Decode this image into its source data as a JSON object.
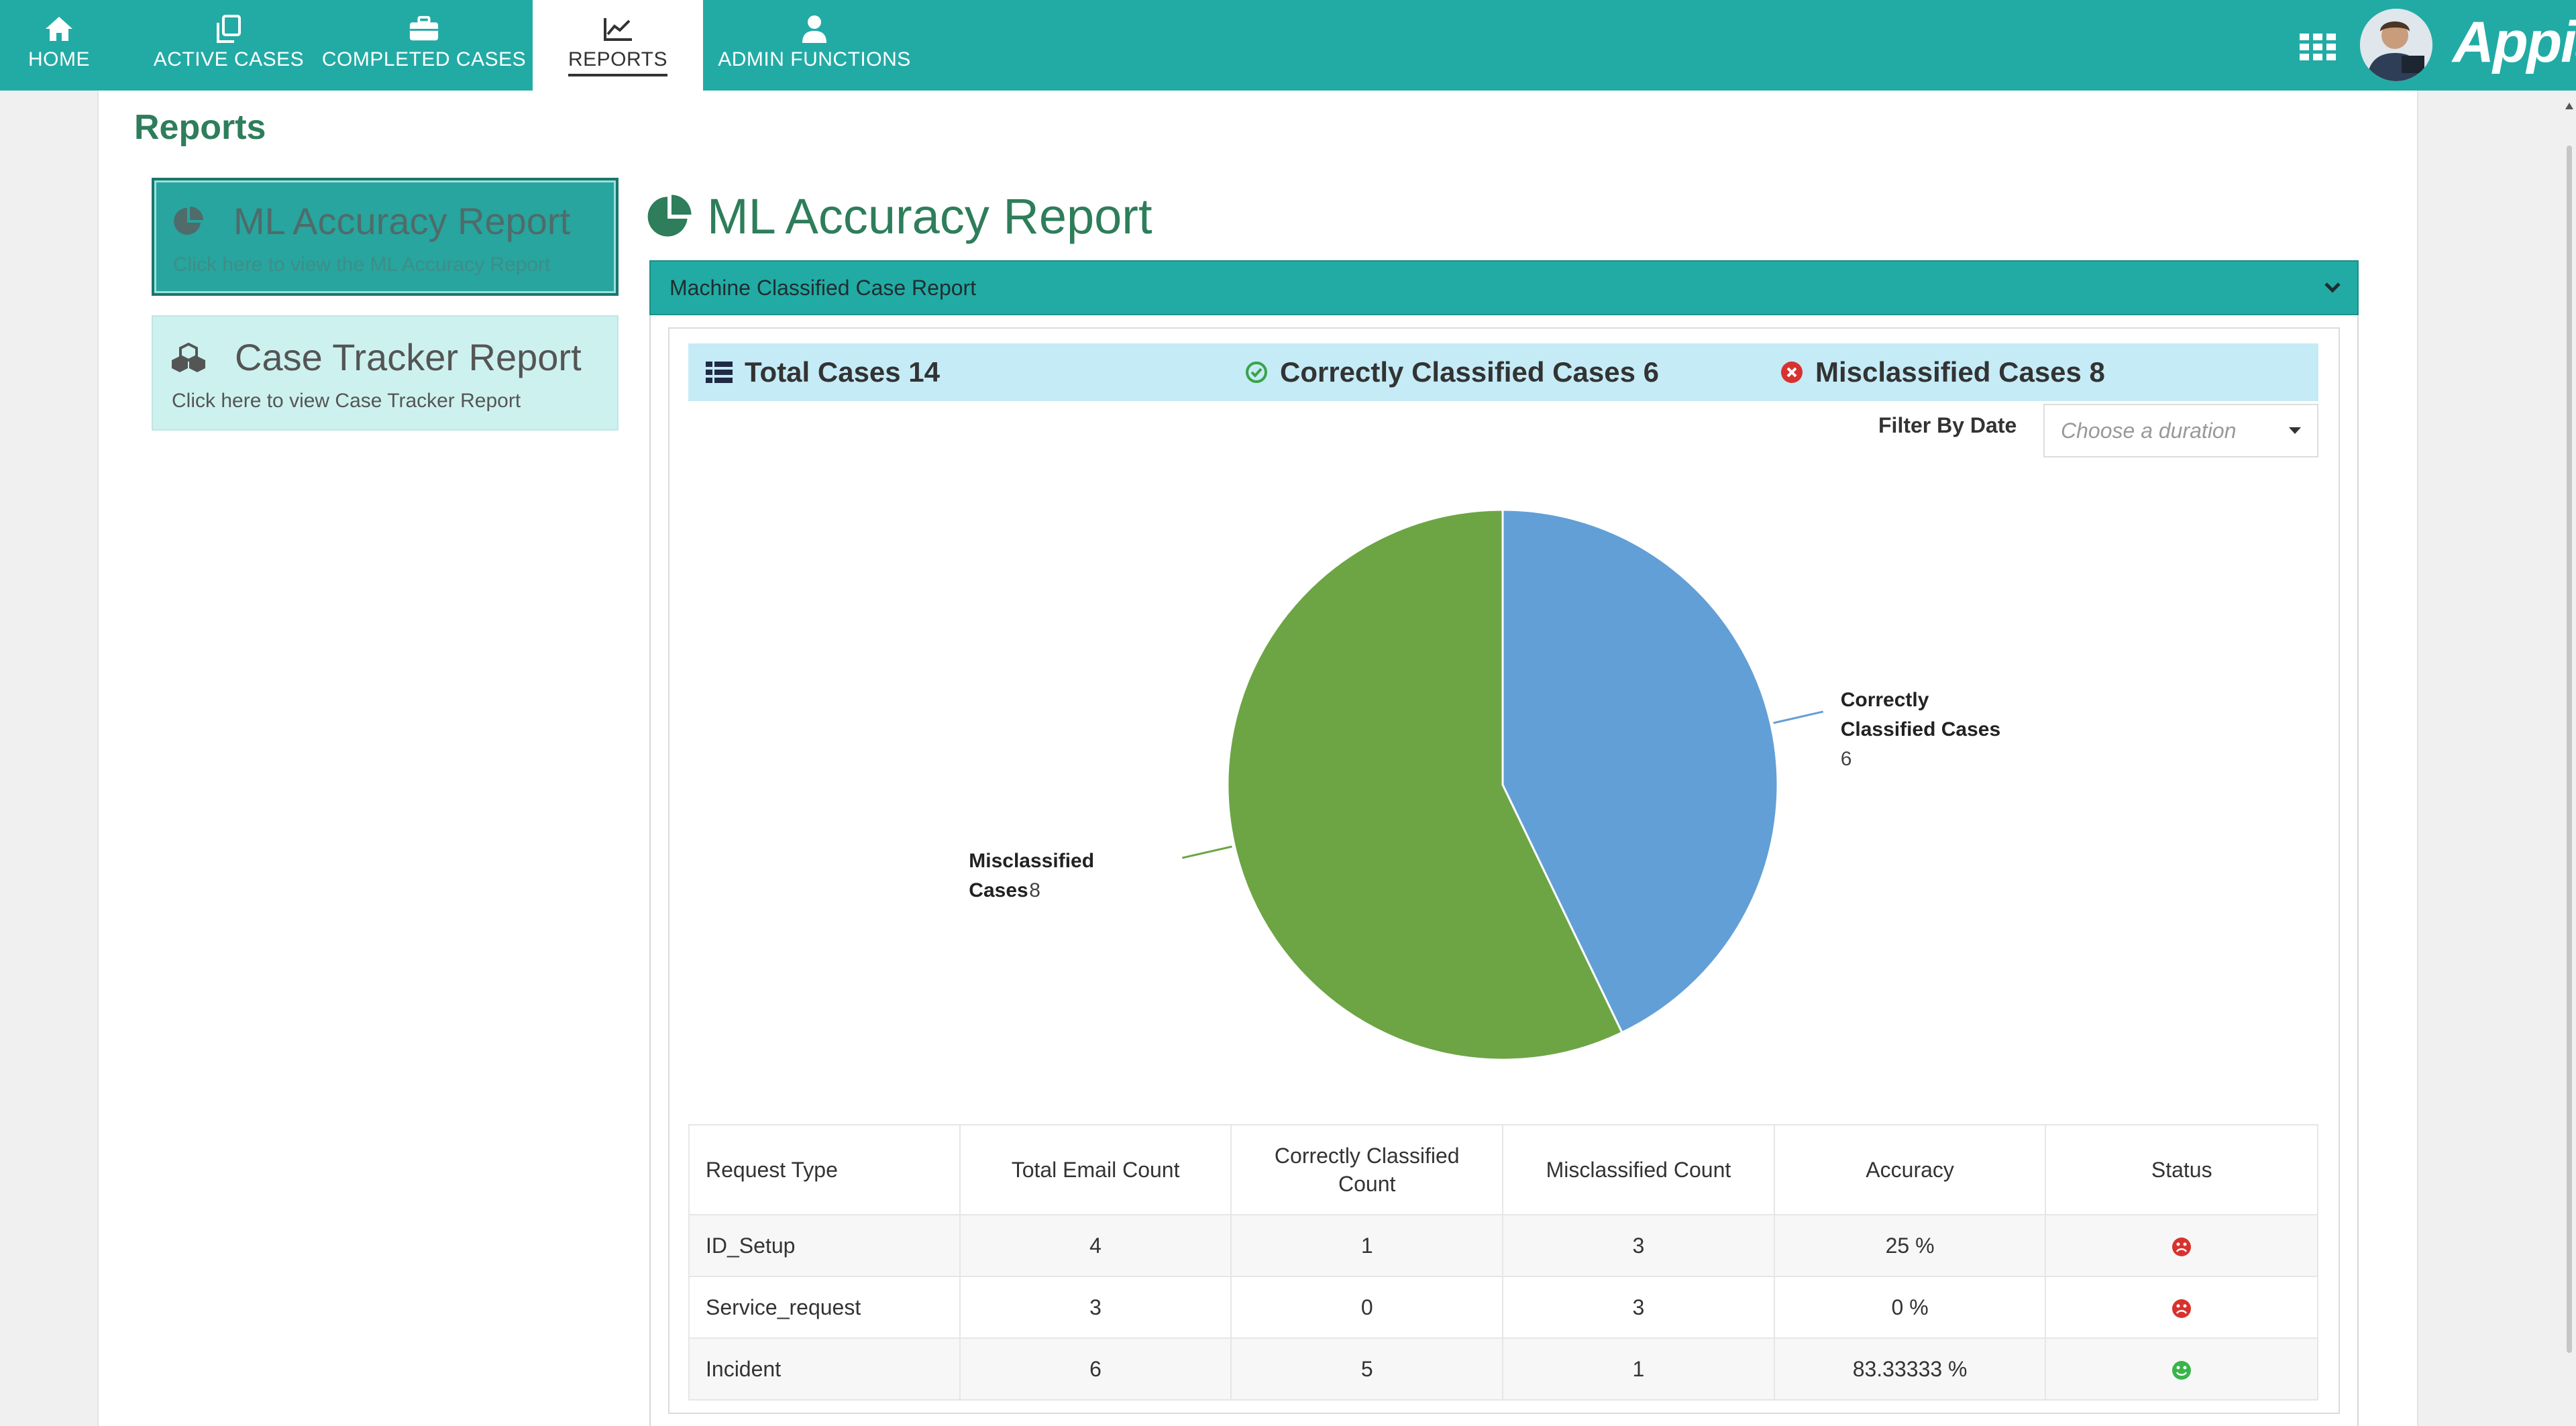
{
  "nav": {
    "tabs": [
      {
        "label": "HOME",
        "icon": "home-icon"
      },
      {
        "label": "ACTIVE CASES",
        "icon": "copy-icon"
      },
      {
        "label": "COMPLETED CASES",
        "icon": "briefcase-icon"
      },
      {
        "label": "REPORTS",
        "icon": "line-chart-icon",
        "active": true
      },
      {
        "label": "ADMIN FUNCTIONS",
        "icon": "user-icon"
      }
    ],
    "brand": "Appian"
  },
  "page": {
    "title": "Reports"
  },
  "cards": {
    "ml": {
      "title": "ML Accuracy Report",
      "subtitle": "Click here to view the ML Accuracy Report"
    },
    "tracker": {
      "title": "Case Tracker Report",
      "subtitle": "Click here to view Case Tracker Report"
    }
  },
  "report": {
    "heading": "ML Accuracy Report",
    "section_title": "Machine Classified Case Report",
    "summary": {
      "total": "Total Cases 14",
      "correct": "Correctly Classified Cases 6",
      "misclassified": "Misclassified Cases 8"
    },
    "filter": {
      "label": "Filter By Date",
      "placeholder": "Choose a duration"
    }
  },
  "colors": {
    "teal": "#22aba5",
    "correct": "#629fd6",
    "misclassified": "#6da545",
    "status_bad": "#d8322f",
    "status_good": "#39b54a"
  },
  "chart_data": {
    "type": "pie",
    "slices": [
      {
        "name": "Correctly Classified Cases",
        "label_line1": "Correctly",
        "label_line2": "Classified Cases",
        "value": 6,
        "color": "#629fd6"
      },
      {
        "name": "Misclassified Cases",
        "label_line1": "Misclassified",
        "label_line2": "Cases",
        "value": 8,
        "color": "#6da545"
      }
    ]
  },
  "table": {
    "headers": [
      "Request Type",
      "Total Email Count",
      "Correctly Classified Count",
      "Misclassified Count",
      "Accuracy",
      "Status"
    ],
    "rows": [
      {
        "type": "ID_Setup",
        "total": "4",
        "correct": "1",
        "misclassified": "3",
        "accuracy": "25 %",
        "status": "sad-face-icon"
      },
      {
        "type": "Service_request",
        "total": "3",
        "correct": "0",
        "misclassified": "3",
        "accuracy": "0 %",
        "status": "sad-face-icon"
      },
      {
        "type": "Incident",
        "total": "6",
        "correct": "5",
        "misclassified": "1",
        "accuracy": "83.33333 %",
        "status": "smile-face-icon"
      }
    ]
  }
}
